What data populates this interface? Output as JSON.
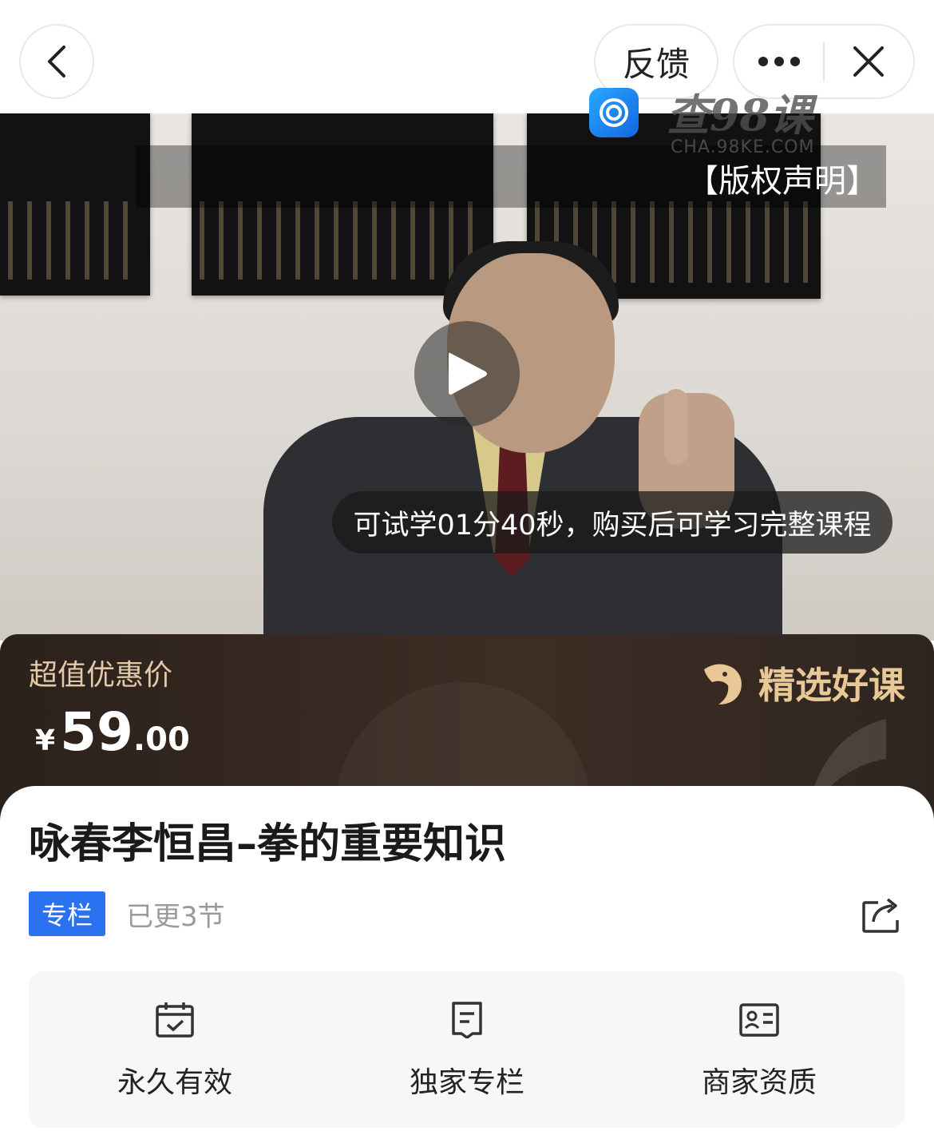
{
  "topbar": {
    "feedback_label": "反馈"
  },
  "video": {
    "copyright_label": "【版权声明】",
    "watermark_text": "查98课",
    "watermark_url": "CHA.98KE.COM",
    "trial_notice": "可试学01分40秒，购买后可学习完整课程"
  },
  "price_band": {
    "label": "超值优惠价",
    "currency": "¥",
    "price_integer": "59",
    "price_decimal": ".00",
    "badge_text": "精选好课"
  },
  "course": {
    "title": "咏春李恒昌–拳的重要知识",
    "tag": "专栏",
    "update_status": "已更3节"
  },
  "features": [
    {
      "label": "永久有效",
      "icon": "calendar-check-icon"
    },
    {
      "label": "独家专栏",
      "icon": "document-icon"
    },
    {
      "label": "商家资质",
      "icon": "id-card-icon"
    }
  ],
  "colors": {
    "accent": "#2b72f0",
    "band_text": "#e3c9a8",
    "badge_gold": "#e8c896"
  }
}
